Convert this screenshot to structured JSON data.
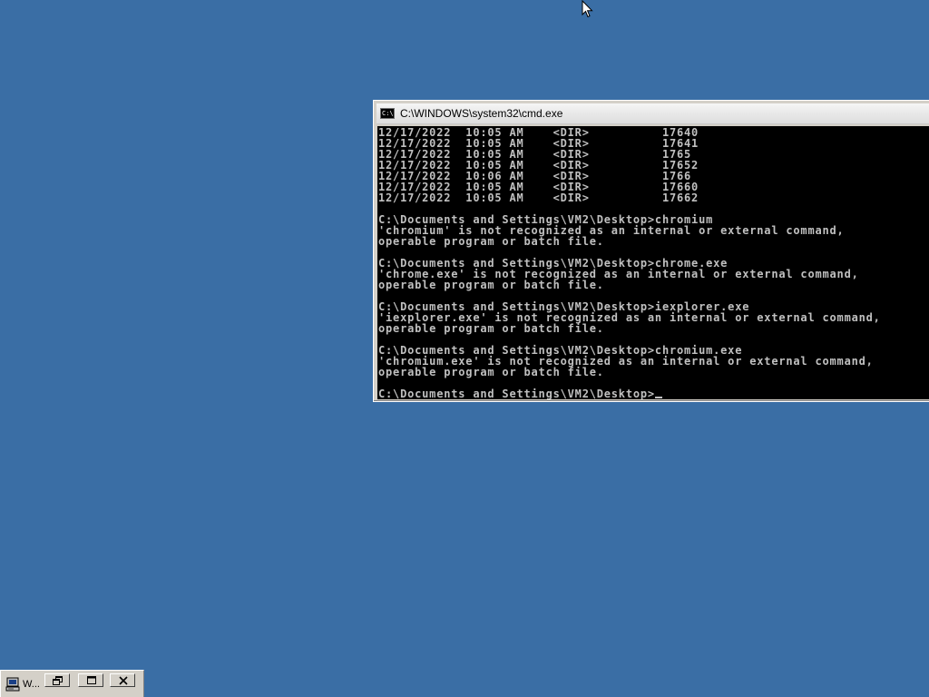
{
  "cmd_window": {
    "title": "C:\\WINDOWS\\system32\\cmd.exe",
    "icon": "console-icon",
    "icon_text": "C:\\",
    "lines": [
      "12/17/2022  10:05 AM    <DIR>          17640",
      "12/17/2022  10:05 AM    <DIR>          17641",
      "12/17/2022  10:05 AM    <DIR>          1765",
      "12/17/2022  10:05 AM    <DIR>          17652",
      "12/17/2022  10:06 AM    <DIR>          1766",
      "12/17/2022  10:05 AM    <DIR>          17660",
      "12/17/2022  10:05 AM    <DIR>          17662",
      "",
      "C:\\Documents and Settings\\VM2\\Desktop>chromium",
      "'chromium' is not recognized as an internal or external command,",
      "operable program or batch file.",
      "",
      "C:\\Documents and Settings\\VM2\\Desktop>chrome.exe",
      "'chrome.exe' is not recognized as an internal or external command,",
      "operable program or batch file.",
      "",
      "C:\\Documents and Settings\\VM2\\Desktop>iexplorer.exe",
      "'iexplorer.exe' is not recognized as an internal or external command,",
      "operable program or batch file.",
      "",
      "C:\\Documents and Settings\\VM2\\Desktop>chromium.exe",
      "'chromium.exe' is not recognized as an internal or external command,",
      "operable program or batch file.",
      ""
    ],
    "prompt": "C:\\Documents and Settings\\VM2\\Desktop>"
  },
  "taskbar_item": {
    "label": "W...",
    "icon": "computer-icon",
    "buttons": [
      {
        "name": "restore-button",
        "icon": "restore-icon"
      },
      {
        "name": "maximize-button",
        "icon": "maximize-icon"
      },
      {
        "name": "close-button",
        "icon": "close-icon"
      }
    ]
  },
  "colors": {
    "desktop": "#3a6ea5",
    "console_bg": "#000000",
    "console_fg": "#c0c0c0",
    "chrome": "#d4d0c8"
  }
}
